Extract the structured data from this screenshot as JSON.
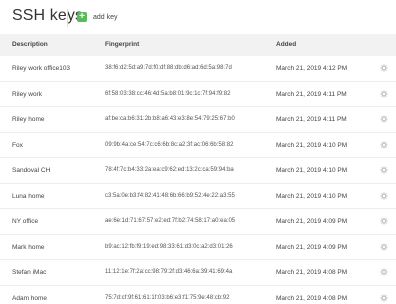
{
  "header": {
    "title": "SSH keys",
    "add_label": "add key",
    "add_icon": "plus-icon",
    "accent_color": "#5cb85c"
  },
  "table": {
    "columns": [
      "Description",
      "Fingerprint",
      "Added"
    ],
    "rows": [
      {
        "description": "Riley work office103",
        "fingerprint": "38:f6:d2:5d:a9:7d:f0:df:88:db:d6:ad:6d:5a:98:7d",
        "added": "March 21, 2019 4:12 PM"
      },
      {
        "description": "Riley work",
        "fingerprint": "6f:58:03:38:cc:46:4d:5a:b8:01:9c:1c:7f:94:f9:82",
        "added": "March 21, 2019 4:11 PM"
      },
      {
        "description": "Riley home",
        "fingerprint": "af:be:ca:b6:31:2b:b8:a6:43:e3:8e:54:79:25:67:b0",
        "added": "March 21, 2019 4:11 PM"
      },
      {
        "description": "Fox",
        "fingerprint": "09:9b:4a:ce:54:7c:c6:6b:8c:a2:3f:ac:06:6b:58:82",
        "added": "March 21, 2019 4:10 PM"
      },
      {
        "description": "Sandoval CH",
        "fingerprint": "78:4f:7c:b4:33:2a:ea:c9:62:ed:13:2c:ca:59:94:ba",
        "added": "March 21, 2019 4:10 PM"
      },
      {
        "description": "Luna home",
        "fingerprint": "c3:5a:0e:b3:f4:82:41:48:6b:66:b9:52:4e:22:a3:55",
        "added": "March 21, 2019 4:10 PM"
      },
      {
        "description": "NY office",
        "fingerprint": "ae:6e:1d:71:67:57:e2:ed:7f:b2:74:58:17:a0:ea:05",
        "added": "March 21, 2019 4:09 PM"
      },
      {
        "description": "Mark home",
        "fingerprint": "b9:ac:12:fb:f9:19:ed:98:33:61:d3:0c:a2:d3:01:26",
        "added": "March 21, 2019 4:09 PM"
      },
      {
        "description": "Stefan iMac",
        "fingerprint": "11:12:1e:7f:2a:cc:98:79:2f:d3:46:6a:39:41:69:4a",
        "added": "March 21, 2019 4:08 PM"
      },
      {
        "description": "Adam home",
        "fingerprint": "75:7d:cf:9f:61:61:1f:03:b6:e3:f1:75:9e:48:cb:92",
        "added": "March 21, 2019 4:08 PM"
      }
    ],
    "row_action_icon": "gear-icon"
  }
}
